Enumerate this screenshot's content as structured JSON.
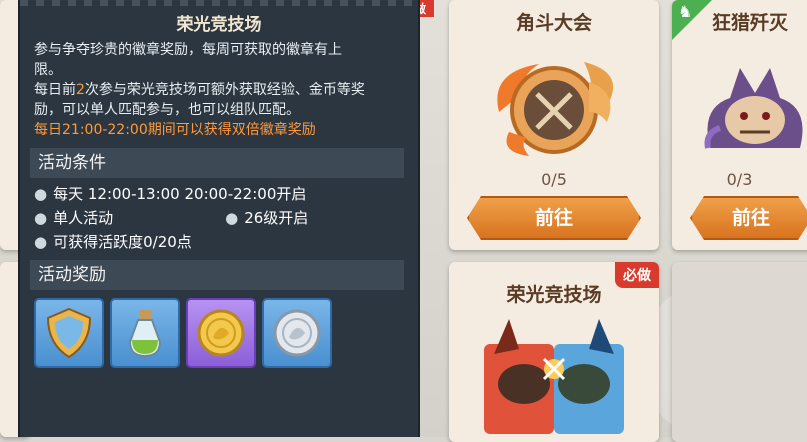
{
  "panel": {
    "title": "荣光竞技场",
    "desc_line1": "参与争夺珍贵的徽章奖励，每周可获取的徽章有上",
    "desc_line2": "限。",
    "desc_line3_a": "每日前",
    "desc_line3_hl": "2",
    "desc_line3_b": "次参与荣光竞技场可额外获取经验、金币等奖",
    "desc_line4": "励，可以单人匹配参与，也可以组队匹配。",
    "desc_line5": "每日21:00-22:00期间可以获得双倍徽章奖励",
    "conditions_head": "活动条件",
    "conditions": {
      "time": "每天  12:00-13:00  20:00-22:00开启",
      "mode": "单人活动",
      "level": "26级开启",
      "activity": "可获得活跃度0/20点"
    },
    "rewards_head": "活动奖励",
    "rewards": [
      {
        "icon": "shield-badge-icon",
        "rarity": "blue"
      },
      {
        "icon": "potion-bottle-icon",
        "rarity": "blue"
      },
      {
        "icon": "gold-coin-icon",
        "rarity": "purple"
      },
      {
        "icon": "silver-coin-icon",
        "rarity": "blue"
      }
    ]
  },
  "cards": {
    "arena": {
      "title": "角斗大会",
      "progress": "0/5",
      "go_label": "前往"
    },
    "hunt": {
      "title": "狂猎歼灭",
      "progress": "0/3",
      "go_label": "前往"
    },
    "glory": {
      "title": "荣光竞技场",
      "tag": "必做"
    }
  },
  "top_tag": "做",
  "colors": {
    "accent_orange": "#d8731f",
    "highlight": "#ff9a3c",
    "panel_bg": "#2c3640"
  }
}
